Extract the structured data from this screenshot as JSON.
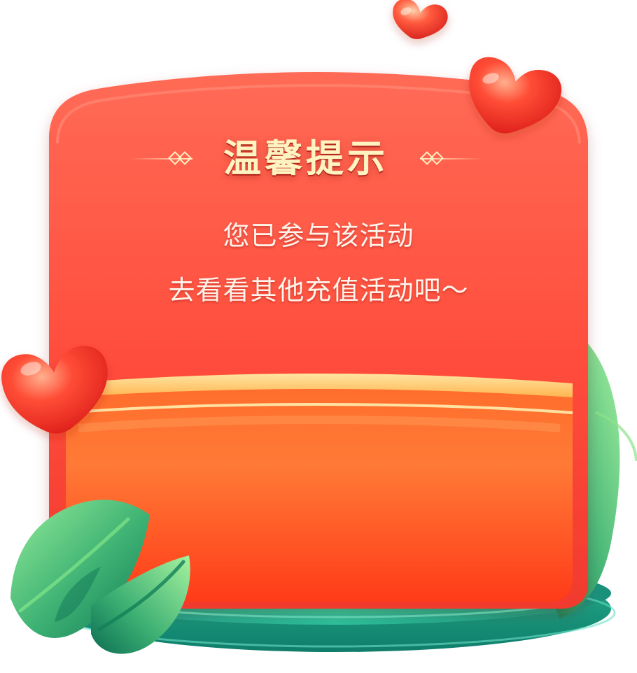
{
  "dialog": {
    "title": "温馨提示",
    "message_line_1": "您已参与该活动",
    "message_line_2": "去看看其他充值活动吧～"
  },
  "palette": {
    "card_red": "#ff4f3f",
    "pocket_red": "#ff5d31",
    "accent_gold": "#fff1c4",
    "leaf_green": "#3fb36f",
    "platform_green": "#1fa889"
  },
  "icons": {
    "top_small": "heart-icon",
    "top_large": "heart-icon",
    "left": "heart-icon",
    "leaf_left": "leaf-icon",
    "leaf_right": "leaf-icon"
  }
}
